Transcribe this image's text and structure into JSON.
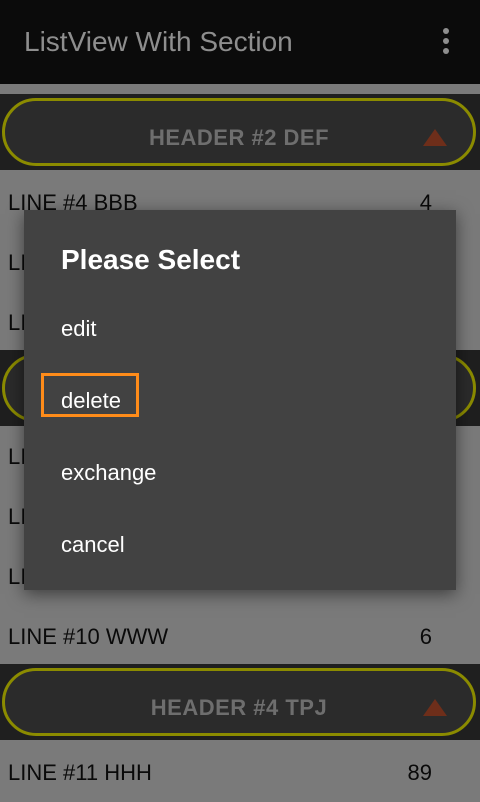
{
  "appbar": {
    "title": "ListView With Section",
    "menu_icon": "more-vert-icon"
  },
  "list": {
    "headers": [
      {
        "label": "HEADER #2 DEF",
        "icon": "triangle-up-icon"
      },
      {
        "label": "",
        "icon": "triangle-up-icon"
      },
      {
        "label": "HEADER #4 TPJ",
        "icon": "triangle-up-icon"
      }
    ],
    "lines": [
      {
        "label": "LINE #4 BBB",
        "value": "4"
      },
      {
        "label": "LI",
        "value": ""
      },
      {
        "label": "LI",
        "value": ""
      },
      {
        "label": "LI",
        "value": ""
      },
      {
        "label": "LI",
        "value": ""
      },
      {
        "label": "LI",
        "value": ""
      },
      {
        "label": "LINE #10 WWW",
        "value": "6"
      },
      {
        "label": "LINE #11 HHH",
        "value": "89"
      }
    ]
  },
  "dialog": {
    "title": "Please Select",
    "items": [
      {
        "label": "edit"
      },
      {
        "label": "delete"
      },
      {
        "label": "exchange"
      },
      {
        "label": "cancel"
      }
    ],
    "highlight_color": "#ff8c1a"
  },
  "colors": {
    "appbar_bg": "#0b0b0b",
    "header_border": "#8b8b00",
    "arrow": "#6e2e1a",
    "dialog_bg": "#424242"
  }
}
